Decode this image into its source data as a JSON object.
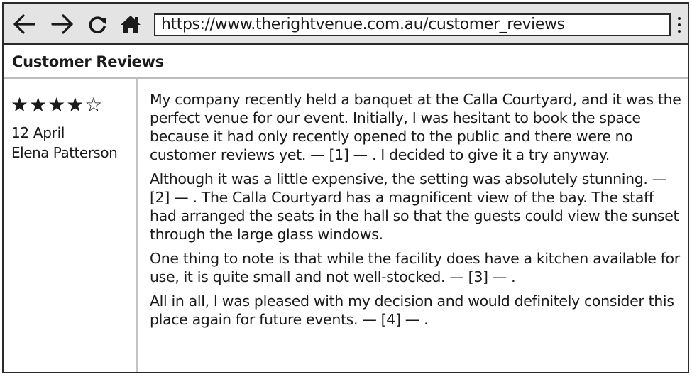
{
  "browser": {
    "url": "https://www.therightvenue.com.au/customer_reviews",
    "icons": [
      "back-arrow-icon",
      "forward-arrow-icon",
      "reload-icon",
      "home-icon",
      "menu-icon"
    ]
  },
  "page": {
    "title": "Customer Reviews"
  },
  "review": {
    "rating": 4,
    "max_rating": 5,
    "stars_text": "★★★★☆",
    "date": "12 April",
    "reviewer": "Elena Patterson",
    "paragraphs": [
      "My company recently held a banquet at the Calla Courtyard, and it was the perfect venue for our event. Initially, I was hesitant to book the space because it had only recently opened to the public and there were no customer reviews yet. — [1] — . I decided to give it a try anyway.",
      "Although it was a little expensive, the setting was absolutely stunning. — [2] — . The Calla Courtyard has a magnificent view of the bay. The staff had arranged the seats in the hall so that the guests could view the sunset through the large glass windows.",
      "One thing to note is that while the facility does have a kitchen available for use, it is quite small and not well-stocked. — [3] — .",
      "All in all, I was pleased with my decision and would definitely consider this place again for future events. — [4] — ."
    ]
  }
}
